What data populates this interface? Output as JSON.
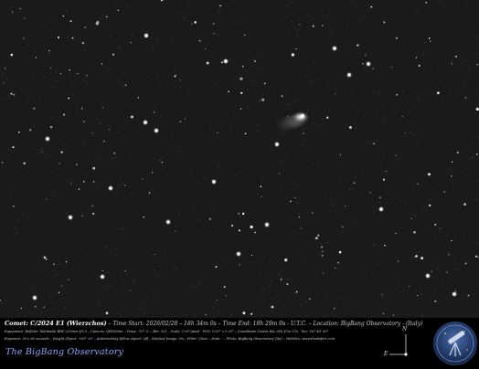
{
  "caption": {
    "object_label": "Comet: C/2024 E1 (Wierzchos)",
    "time_start": "– Time Start: 2026/02/28 – 18h 34m 0s",
    "time_end": "– Time End: 18h 29m 0s - U.T.C.",
    "location": "– Location: BigBang Observatory - (Italy)",
    "equipment": "Equipment: Refletor Takahashi BRC-250mm f/5.0 – Camera: QHY600m – Temp: -10° C. – Bin: 1x1 – Scale: 1.03\"/pixel · FOV: 1.03° x 1.03° – Coordinate Center RA: 01h 47m 11s · Dec -16° 40' 00\"",
    "exposure": "Exposure: 20 x 60 seconds – Height Object: +63° 35' – Autotracking follow object: Off – Stacked Image: On – Filter: Clear – Note: - – Photo: BigBang Observatory (Ita) – WebSite: www.dustisfire.com"
  },
  "observatory_name": "The BigBang Observatory",
  "compass": {
    "north": "N",
    "east": "E"
  },
  "logo_icon": "observatory-telescope-logo"
}
